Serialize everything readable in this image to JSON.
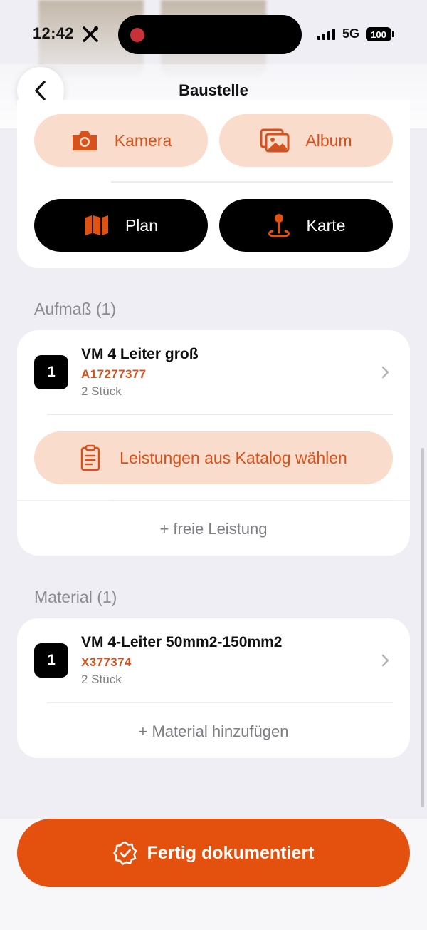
{
  "status_bar": {
    "time": "12:42",
    "network": "5G",
    "battery": "100"
  },
  "nav": {
    "title": "Baustelle"
  },
  "capture": {
    "camera_label": "Kamera",
    "album_label": "Album",
    "plan_label": "Plan",
    "map_label": "Karte"
  },
  "aufmass": {
    "section_title": "Aufmaß (1)",
    "items": [
      {
        "qty": "1",
        "title": "VM 4 Leiter groß",
        "code": "A17277377",
        "count": "2 Stück"
      }
    ],
    "catalog_button": "Leistungen aus Katalog wählen",
    "add_free": "+ freie Leistung"
  },
  "material": {
    "section_title": "Material (1)",
    "items": [
      {
        "qty": "1",
        "title": "VM 4-Leiter 50mm2-150mm2",
        "code": "X377374",
        "count": "2 Stück"
      }
    ],
    "add_material": "+ Material hinzufügen"
  },
  "footer": {
    "done_label": "Fertig dokumentiert"
  },
  "colors": {
    "accent": "#e4500e",
    "accent_light": "#fadccd",
    "background": "#efeef4"
  }
}
